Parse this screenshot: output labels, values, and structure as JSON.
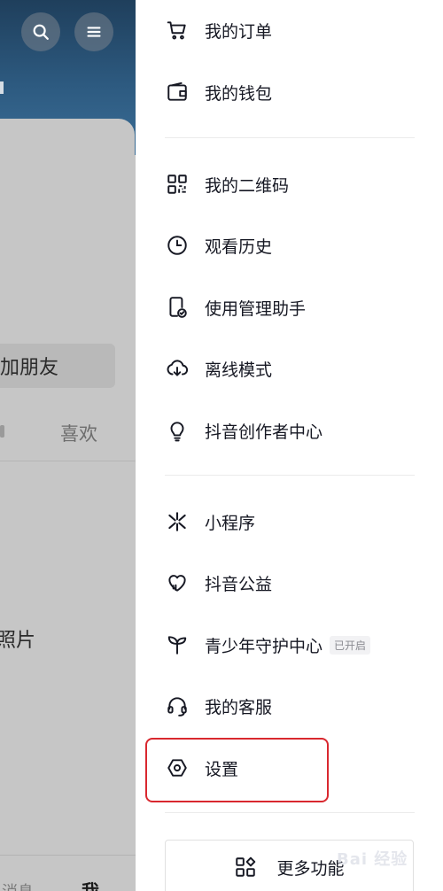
{
  "background_page": {
    "add_friend_label": "加朋友",
    "tab_like_label": "喜欢",
    "photos_label": "照片",
    "bottom_nav_left": "消息",
    "bottom_nav_me": "我"
  },
  "drawer": {
    "items": [
      {
        "label": "我的订单",
        "icon": "cart-icon"
      },
      {
        "label": "我的钱包",
        "icon": "wallet-icon"
      },
      {
        "label": "我的二维码",
        "icon": "qr-code-icon"
      },
      {
        "label": "观看历史",
        "icon": "clock-icon"
      },
      {
        "label": "使用管理助手",
        "icon": "phone-check-icon"
      },
      {
        "label": "离线模式",
        "icon": "cloud-download-icon"
      },
      {
        "label": "抖音创作者中心",
        "icon": "lightbulb-icon"
      },
      {
        "label": "小程序",
        "icon": "mini-program-icon"
      },
      {
        "label": "抖音公益",
        "icon": "heart-icon"
      },
      {
        "label": "青少年守护中心",
        "icon": "sprout-icon",
        "badge": "已开启"
      },
      {
        "label": "我的客服",
        "icon": "headset-icon"
      },
      {
        "label": "设置",
        "icon": "settings-hexagon-icon"
      }
    ],
    "more_button_label": "更多功能"
  },
  "watermark": "Bai 经验",
  "colors": {
    "highlight": "#d9282f",
    "header_blue": "#2d5a80",
    "dim_overlay": "#c4c4c4"
  }
}
